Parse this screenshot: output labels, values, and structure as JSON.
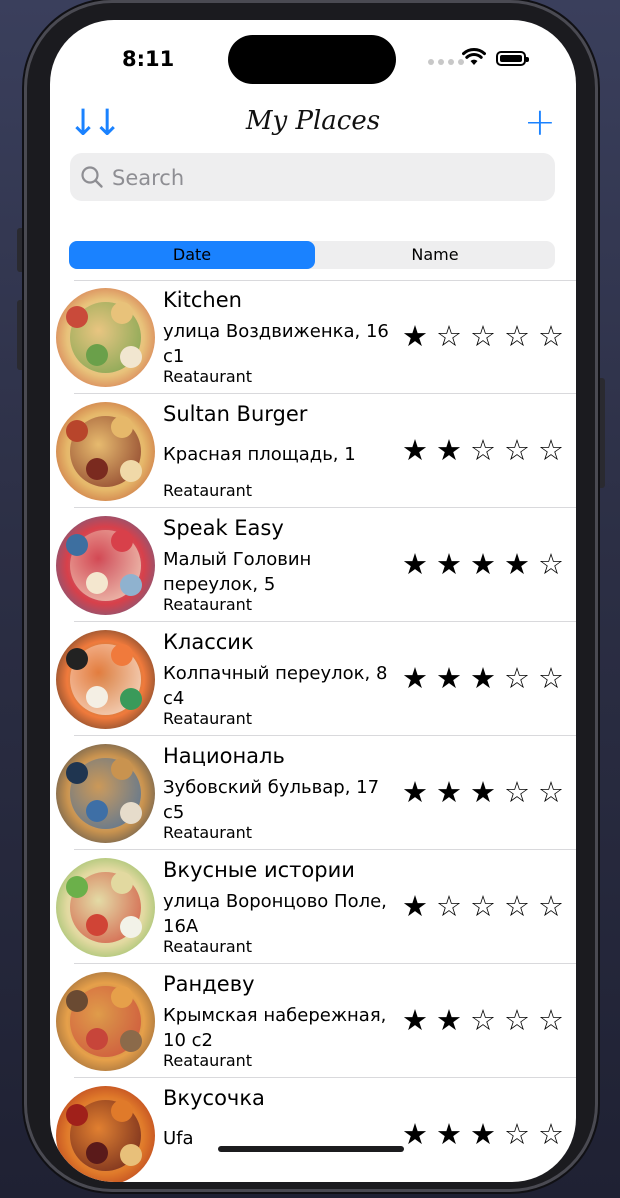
{
  "status": {
    "time": "8:11"
  },
  "nav": {
    "title": "My Places",
    "sort_icon": "↓↓",
    "add_icon": "+"
  },
  "search": {
    "placeholder": "Search",
    "value": ""
  },
  "segmented": {
    "options": [
      "Date",
      "Name"
    ],
    "selected": "Date"
  },
  "colors": {
    "accent": "#1a82ff",
    "separator": "#d9d9dc",
    "field": "#eeeeef"
  },
  "places": [
    {
      "name": "Kitchen",
      "address": "улица Воздвиженка, 16 с1",
      "type": "Reataurant",
      "rating": 1,
      "colors": [
        "#c94a3a",
        "#e8c27a",
        "#6aa04a",
        "#f1e6d0"
      ]
    },
    {
      "name": "Sultan Burger",
      "address": "Красная площадь, 1",
      "type": "Reataurant",
      "rating": 2,
      "colors": [
        "#b8452b",
        "#e6b86a",
        "#7a2a1f",
        "#f0d9a8"
      ]
    },
    {
      "name": "Speak Easy",
      "address": "Малый Головин переулок, 5",
      "type": "Reataurant",
      "rating": 4,
      "colors": [
        "#3d6fa0",
        "#d8404a",
        "#f4e7cf",
        "#8fb2cf"
      ]
    },
    {
      "name": "Классик",
      "address": "Колпачный переулок, 8 с4",
      "type": "Reataurant",
      "rating": 3,
      "colors": [
        "#222222",
        "#f07a3c",
        "#f4efe4",
        "#3a9a5a"
      ]
    },
    {
      "name": "Националь",
      "address": "Зубовский бульвар, 17 с5",
      "type": "Reataurant",
      "rating": 3,
      "colors": [
        "#1f3550",
        "#c9934f",
        "#3e6fa6",
        "#e6dccb"
      ]
    },
    {
      "name": "Вкусные истории",
      "address": "улица Воронцово Поле, 16А",
      "type": "Reataurant",
      "rating": 1,
      "colors": [
        "#6bb04a",
        "#e2d9a0",
        "#d04436",
        "#f2f2e8"
      ]
    },
    {
      "name": "Рандеву",
      "address": "Крымская набережная, 10 с2",
      "type": "Reataurant",
      "rating": 2,
      "colors": [
        "#6a4a32",
        "#e6a04a",
        "#c7453a",
        "#8b6a4a"
      ]
    },
    {
      "name": "Вкусочка",
      "address": "Ufa",
      "type": "",
      "rating": 3,
      "colors": [
        "#a0201a",
        "#e07a2a",
        "#5a1a1a",
        "#e8c07a"
      ]
    }
  ]
}
